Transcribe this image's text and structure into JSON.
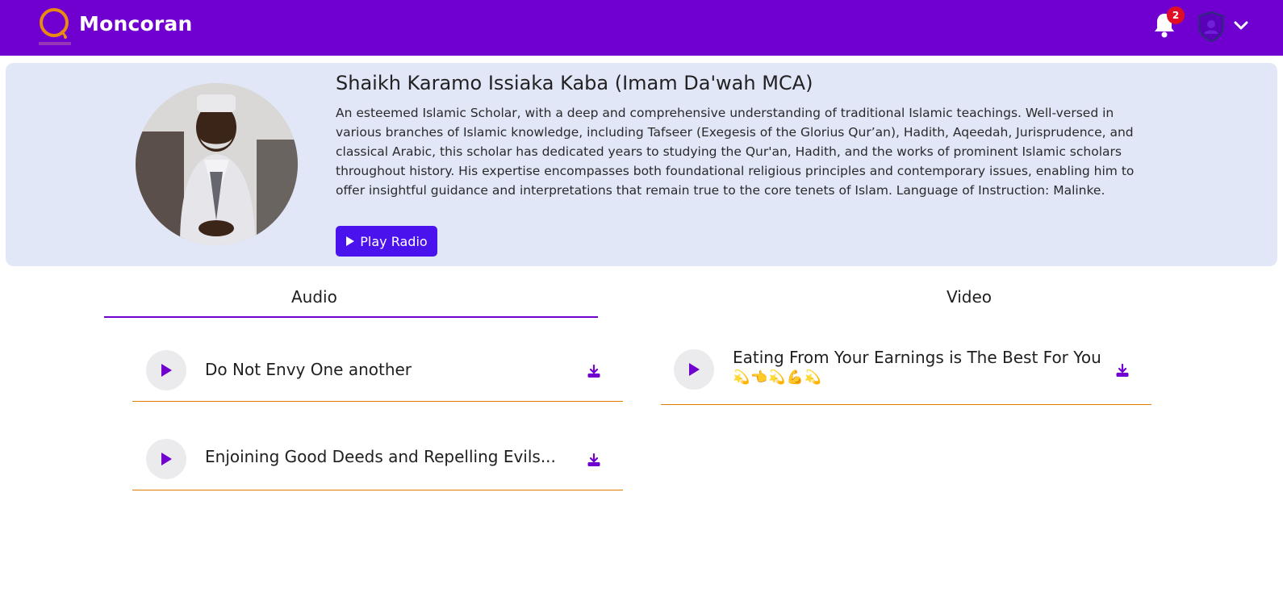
{
  "header": {
    "brand": "Moncoran",
    "notification_count": "2"
  },
  "scholar": {
    "name": "Shaikh Karamo Issiaka Kaba (Imam Da'wah MCA)",
    "bio": "An esteemed Islamic Scholar, with a deep and comprehensive understanding of traditional Islamic teachings. Well-versed in various branches of Islamic knowledge, including Tafseer (Exegesis of the Glorius Qur’an), Hadith, Aqeedah, Jurisprudence, and classical Arabic, this scholar has dedicated years to studying the Qur'an, Hadith, and the works of prominent Islamic scholars throughout history. His expertise encompasses both foundational religious principles and contemporary issues, enabling him to offer insightful guidance and interpretations that remain true to the core tenets of Islam. Language of Instruction: Malinke.",
    "play_radio_label": "Play Radio"
  },
  "tabs": {
    "audio": "Audio",
    "video": "Video",
    "active": "audio"
  },
  "audio_items": [
    {
      "title": "Do Not Envy One another"
    },
    {
      "title": "Enjoining Good Deeds and Repelling Evils..."
    }
  ],
  "video_items": [
    {
      "title": "Eating From Your Earnings is The Best For You",
      "emoji": "💫👈💫💪💫"
    }
  ],
  "colors": {
    "brand_purple": "#6f00cf",
    "button_blue": "#4a12ec",
    "card_bg": "#e2e7f8",
    "divider_orange": "#e07b00",
    "badge_red": "#e00d27",
    "logo_orange": "#e98a12"
  },
  "icons": {
    "logo": "moncoran-logo-icon",
    "notifications": "bell-icon",
    "profile": "shield-avatar-icon",
    "menu": "chevron-down-icon",
    "play": "play-icon",
    "download": "download-icon"
  }
}
